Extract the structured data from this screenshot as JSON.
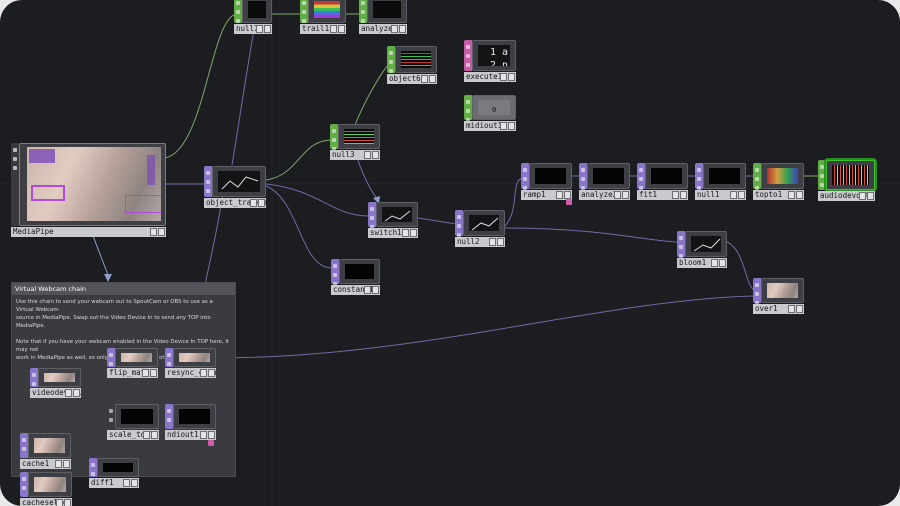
{
  "app": {
    "accent": "#8a76c9",
    "chop_color": "#62ad46",
    "dat_color": "#c45da6",
    "selected_outline": "#3cc12a"
  },
  "nodes": {
    "null7": "null7",
    "trail1": "trail1",
    "analyze1": "analyze1",
    "object6": "object6",
    "execute1": "execute1",
    "midiout1": "midiout1",
    "mediapipe": "MediaPipe",
    "object_tracking": "object_tracking",
    "null3": "null3",
    "switch1": "switch1",
    "constant1": "constant1",
    "null2": "null2",
    "ramp1": "ramp1",
    "analyze2": "analyze2",
    "fit1": "fit1",
    "null1": "null1",
    "topto1": "topto1",
    "audiodevout1": "audiodevout1",
    "bloom1": "bloom1",
    "over1": "over1",
    "flip_match": "flip_match",
    "resync_cache": "resync_cache",
    "videodevin1": "videodevin1",
    "scale_to_720p": "scale_to_720p",
    "ndiout1": "ndiout1",
    "cache1": "cache1",
    "diff1": "diff1",
    "cacheselect1": "cacheselect1"
  },
  "execute_viewer": {
    "line1": "1 a",
    "line2": "2 n"
  },
  "midiout_viewer": "0 ch1",
  "comment": {
    "title": "Virtual Webcam chain",
    "p1_l1": "Use this chain to send your webcam out to SpoutCam or OBS to use as a Virtual Webcam",
    "p1_l2": "source in MediaPipe. Swap out the Video Device In to send any TOP into MediaPipe.",
    "p2_l1": "Note that if you have your webcam enabled in the Video Device In TOP here, it may not",
    "p2_l2": "work in MediaPipe as well, so only enable one or the other."
  }
}
